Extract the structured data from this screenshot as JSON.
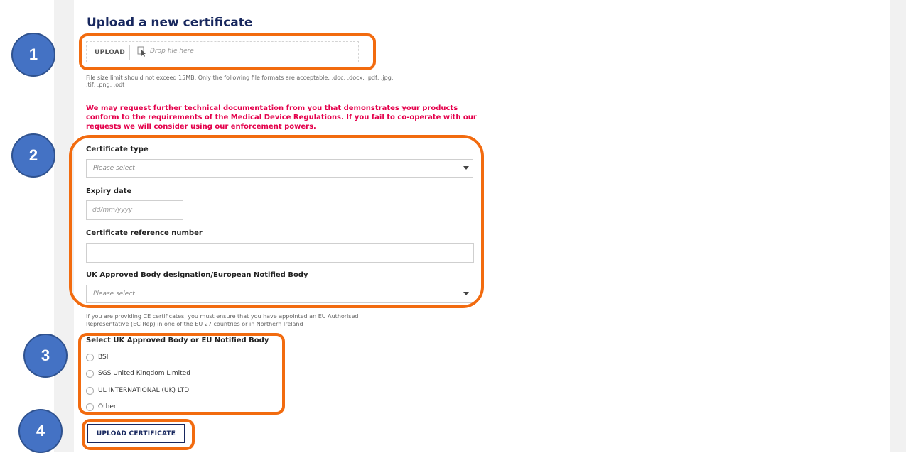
{
  "form": {
    "heading": "Upload a new certificate",
    "upload_button": "UPLOAD",
    "drop_text": "Drop file here",
    "file_help_line1": "File size limit should not exceed 15MB. Only the following file formats are acceptable: .doc, .docx, .pdf, .jpg,",
    "file_help_line2": ".tif, .png, .odt",
    "warning": "We may request further technical documentation from you that demonstrates your products conform to the requirements of the Medical Device Regulations. If you fail to co-operate with our requests we will consider using our enforcement powers.",
    "certificate_type": {
      "label": "Certificate type",
      "value": "Please select"
    },
    "expiry_date": {
      "label": "Expiry date",
      "placeholder": "dd/mm/yyyy"
    },
    "reference_number": {
      "label": "Certificate reference number",
      "value": ""
    },
    "approved_body": {
      "label": "UK Approved Body designation/European Notified Body",
      "value": "Please select"
    },
    "ce_help_line1": "If you are providing CE certificates, you must ensure that you have appointed an EU Authorised",
    "ce_help_line2": "Representative (EC Rep) in one of the EU 27 countries or in Northern Ireland",
    "body_select": {
      "label": "Select UK Approved Body or EU Notified Body",
      "options": [
        "BSI",
        "SGS United Kingdom Limited",
        "UL INTERNATIONAL (UK) LTD",
        "Other"
      ]
    },
    "submit_button": "UPLOAD CERTIFICATE"
  },
  "callouts": [
    "1",
    "2",
    "3",
    "4"
  ],
  "colors": {
    "accent": "#f26b0f",
    "badge": "#4472c4",
    "heading": "#17275e",
    "warning": "#e4004b"
  }
}
